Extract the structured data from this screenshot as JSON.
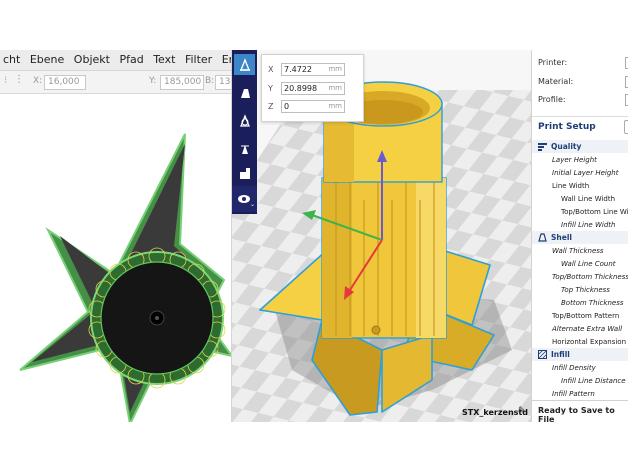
{
  "inkscape": {
    "menu": [
      "cht",
      "Ebene",
      "Objekt",
      "Pfad",
      "Text",
      "Filter",
      "Erweiterungen"
    ],
    "toolbar": {
      "x_label": "X:",
      "x_value": "16,000",
      "y_label": "Y:",
      "y_value": "185,000",
      "b_label": "B:",
      "b_value": "13"
    }
  },
  "cura": {
    "coords": {
      "x_label": "X",
      "x_value": "7.4722",
      "y_label": "Y",
      "y_value": "20.8998",
      "z_label": "Z",
      "z_value": "0",
      "unit": "mm"
    },
    "object_name": "STX_kerzenstd",
    "colors": {
      "toolbar": "#1a1e5a",
      "active_tool": "#3c87c8",
      "model": "#f5d042",
      "outline": "#2e9fd8"
    },
    "tool_icons": [
      "move-icon",
      "scale-icon",
      "rotate-icon",
      "mirror-icon",
      "per-model-settings-icon",
      "view-eye-icon"
    ]
  },
  "settings": {
    "printer_label": "Printer:",
    "material_label": "Material:",
    "profile_label": "Profile:",
    "print_setup": "Print Setup",
    "categories": {
      "quality": {
        "label": "Quality",
        "items": [
          "Layer Height",
          "Initial Layer Height",
          "Line Width",
          "Wall Line Width",
          "Top/Bottom Line Width",
          "Infill Line Width"
        ]
      },
      "shell": {
        "label": "Shell",
        "items": [
          "Wall Thickness",
          "Wall Line Count",
          "Top/Bottom Thickness",
          "Top Thickness",
          "Bottom Thickness",
          "Top/Bottom Pattern",
          "Alternate Extra Wall",
          "Horizontal Expansion"
        ]
      },
      "infill": {
        "label": "Infill",
        "items": [
          "Infill Density",
          "Infill Line Distance",
          "Infill Pattern"
        ]
      }
    },
    "ready": "Ready to Save to File"
  }
}
